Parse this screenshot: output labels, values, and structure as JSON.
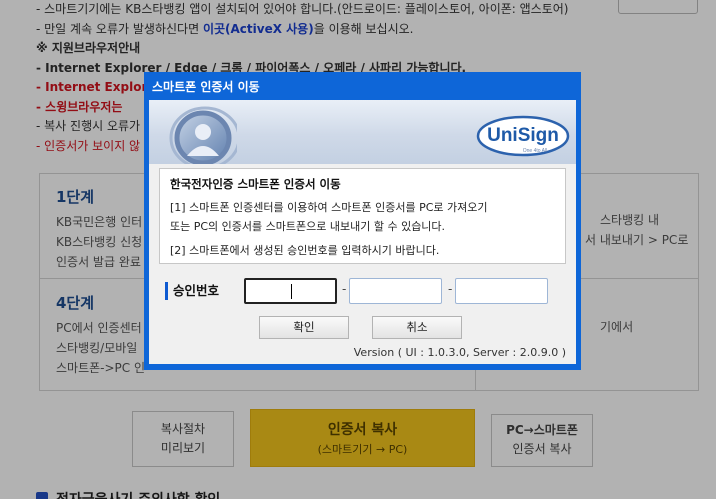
{
  "background": {
    "bullets": [
      {
        "text": "- 스마트기기에는 KB스타뱅킹 앱이 설치되어 있어야 합니다.(안드로이드: 플레이스토어, 아이폰: 앱스토어)",
        "style": "normal"
      },
      {
        "pre": "- 만일 계속 오류가 발생하신다면 ",
        "link": "이곳(ActiveX 사용)",
        "post": "을 이용해 보십시오.",
        "style": "link"
      },
      {
        "text": "※ 지원브라우저안내",
        "style": "bold"
      },
      {
        "text": "- Internet Explorer / Edge / 크롬 / 파이어폭스 / 오페라 / 사파리 가능합니다.",
        "style": "bold"
      },
      {
        "text": "- Internet Explorer",
        "style": "red"
      },
      {
        "text": "- 스윙브라우저는",
        "style": "red"
      },
      {
        "text": "- 복사 진행시 오류가",
        "style": "normal"
      },
      {
        "text": "- 인증서가 보이지 않",
        "style": "red"
      }
    ],
    "steps": {
      "step1": {
        "title": "1단계",
        "lines": [
          "KB국민은행 인터",
          "KB스타뱅킹 신청",
          "인증서 발급 완료"
        ]
      },
      "step4": {
        "title": "4단계",
        "lines": [
          "PC에서 인증센터",
          "스타뱅킹/모바일",
          "스마트폰->PC 인"
        ]
      },
      "right_lines_top": [
        "스타뱅킹 내",
        "서 내보내기 > PC로"
      ],
      "right_lines_bottom": [
        "기에서"
      ]
    },
    "buttons": {
      "guide_line1": "복사절차",
      "guide_line2": "미리보기",
      "copy_main": "인증서 복사",
      "copy_sub": "(스마트기기 → PC)",
      "pc_line1": "PC→스마트폰",
      "pc_line2": "인증서 복사"
    },
    "checkbox_label": "전자금융사기 주의사항 확인"
  },
  "modal": {
    "title": "스마트폰 인증서 이동",
    "brand": "UniSign",
    "brand_tagline": "One 4to All",
    "info_title": "한국전자인증 스마트폰 인증서 이동",
    "info_line1": "[1] 스마트폰 인증센터를 이용하여 스마트폰 인증서를 PC로 가져오기",
    "info_line2": "또는 PC의 인증서를 스마트폰으로 내보내기 할 수 있습니다.",
    "info_line3": "[2] 스마트폰에서 생성된 승인번호를 입력하시기 바랍니다.",
    "auth_label": "승인번호",
    "dash": "-",
    "inputs": [
      {
        "value": "",
        "placeholder": ""
      },
      {
        "value": "",
        "placeholder": ""
      },
      {
        "value": "",
        "placeholder": ""
      }
    ],
    "confirm_label": "확인",
    "cancel_label": "취소",
    "version": "Version ( UI : 1.0.3.0, Server : 2.0.9.0 )"
  },
  "colors": {
    "modal_frame": "#0e66d8",
    "brand_blue": "#1e5aa8",
    "gold_button": "#f3c41d",
    "warning_red": "#d3141f"
  }
}
